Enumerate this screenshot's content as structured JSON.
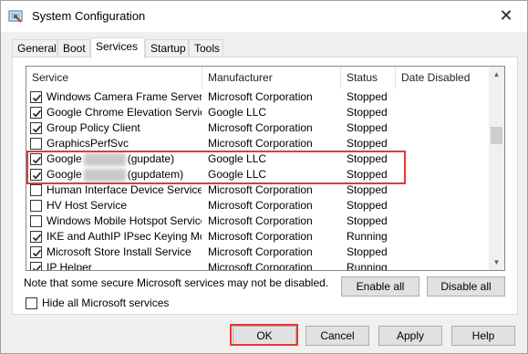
{
  "window": {
    "title": "System Configuration",
    "close_glyph": "✕"
  },
  "tabs": [
    {
      "label": "General"
    },
    {
      "label": "Boot"
    },
    {
      "label": "Services"
    },
    {
      "label": "Startup"
    },
    {
      "label": "Tools"
    }
  ],
  "columns": {
    "service": "Service",
    "manufacturer": "Manufacturer",
    "status": "Status",
    "date_disabled": "Date Disabled"
  },
  "services": [
    {
      "checked": true,
      "name": "Windows Camera Frame Server",
      "manufacturer": "Microsoft Corporation",
      "status": "Stopped",
      "date_disabled": ""
    },
    {
      "checked": true,
      "name": "Google Chrome Elevation Service",
      "manufacturer": "Google LLC",
      "status": "Stopped",
      "date_disabled": ""
    },
    {
      "checked": true,
      "name": "Group Policy Client",
      "manufacturer": "Microsoft Corporation",
      "status": "Stopped",
      "date_disabled": ""
    },
    {
      "checked": false,
      "name": "GraphicsPerfSvc",
      "manufacturer": "Microsoft Corporation",
      "status": "Stopped",
      "date_disabled": ""
    },
    {
      "checked": true,
      "name": "Google",
      "name_suffix": "(gupdate)",
      "redacted": true,
      "manufacturer": "Google LLC",
      "status": "Stopped",
      "date_disabled": ""
    },
    {
      "checked": true,
      "name": "Google",
      "name_suffix": "(gupdatem)",
      "redacted": true,
      "manufacturer": "Google LLC",
      "status": "Stopped",
      "date_disabled": ""
    },
    {
      "checked": false,
      "name": "Human Interface Device Service",
      "manufacturer": "Microsoft Corporation",
      "status": "Stopped",
      "date_disabled": ""
    },
    {
      "checked": false,
      "name": "HV Host Service",
      "manufacturer": "Microsoft Corporation",
      "status": "Stopped",
      "date_disabled": ""
    },
    {
      "checked": false,
      "name": "Windows Mobile Hotspot Service",
      "manufacturer": "Microsoft Corporation",
      "status": "Stopped",
      "date_disabled": ""
    },
    {
      "checked": true,
      "name": "IKE and AuthIP IPsec Keying Mo...",
      "manufacturer": "Microsoft Corporation",
      "status": "Running",
      "date_disabled": ""
    },
    {
      "checked": true,
      "name": "Microsoft Store Install Service",
      "manufacturer": "Microsoft Corporation",
      "status": "Stopped",
      "date_disabled": ""
    },
    {
      "checked": true,
      "name": "IP Helper",
      "manufacturer": "Microsoft Corporation",
      "status": "Running",
      "date_disabled": ""
    }
  ],
  "note": "Note that some secure Microsoft services may not be disabled.",
  "buttons": {
    "enable_all": "Enable all",
    "disable_all": "Disable all",
    "ok": "OK",
    "cancel": "Cancel",
    "apply": "Apply",
    "help": "Help"
  },
  "hide_ms": {
    "label": "Hide all Microsoft services",
    "checked": false
  },
  "colors": {
    "highlight": "#e53935",
    "accent": "#0078d7"
  }
}
